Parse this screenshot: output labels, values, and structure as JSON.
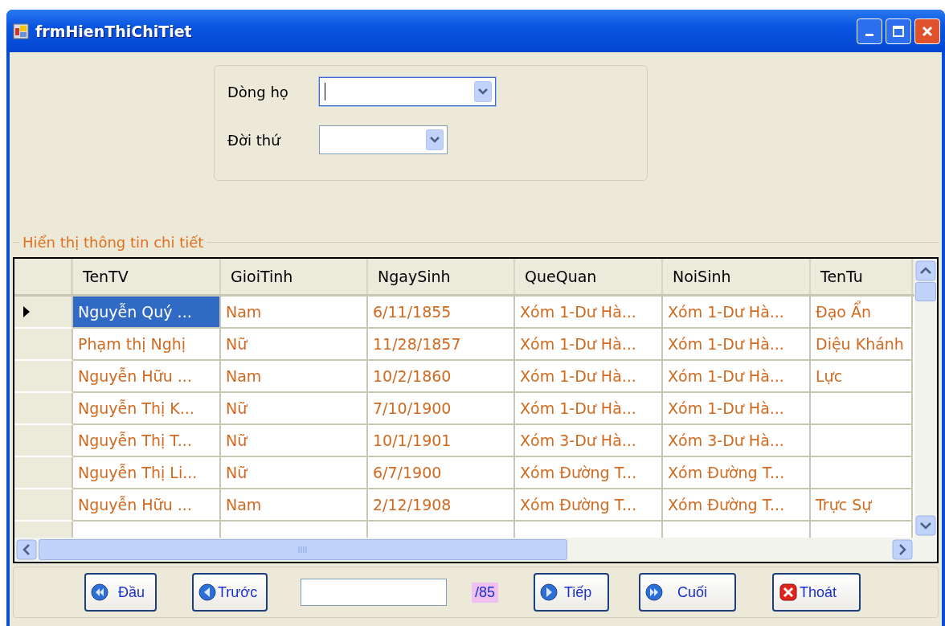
{
  "window": {
    "title": "frmHienThiChiTiet"
  },
  "filters": [
    {
      "label": "Dòng họ",
      "focused": true,
      "wide": true
    },
    {
      "label": "Đời thứ",
      "focused": false,
      "wide": false
    }
  ],
  "details": {
    "title": "Hiển thị thông tin chi tiết",
    "columns": [
      "TenTV",
      "GioiTinh",
      "NgaySinh",
      "QueQuan",
      "NoiSinh",
      "TenTu"
    ],
    "rows": [
      {
        "selected": true,
        "cells": [
          "Nguyễn Quý ...",
          "Nam",
          "6/11/1855",
          "Xóm 1-Dư Hà...",
          "Xóm 1-Dư Hà...",
          "Đạo Ẩn"
        ]
      },
      {
        "selected": false,
        "cells": [
          "Phạm thị Nghị",
          "Nữ",
          "11/28/1857",
          "Xóm 1-Dư Hà...",
          "Xóm 1-Dư Hà...",
          "Diệu Khánh"
        ]
      },
      {
        "selected": false,
        "cells": [
          "Nguyễn Hữu ...",
          "Nam",
          "10/2/1860",
          "Xóm 1-Dư Hà...",
          "Xóm 1-Dư Hà...",
          "Lực"
        ]
      },
      {
        "selected": false,
        "cells": [
          "Nguyễn Thị K...",
          "Nữ",
          "7/10/1900",
          "Xóm 1-Dư Hà...",
          "Xóm 1-Dư Hà...",
          ""
        ]
      },
      {
        "selected": false,
        "cells": [
          "Nguyễn Thị T...",
          "Nữ",
          "10/1/1901",
          "Xóm 3-Dư Hà...",
          "Xóm 3-Dư Hà...",
          ""
        ]
      },
      {
        "selected": false,
        "cells": [
          "Nguyễn Thị Li...",
          "Nữ",
          "6/7/1900",
          "Xóm Đường T...",
          "Xóm Đường T...",
          ""
        ]
      },
      {
        "selected": false,
        "cells": [
          "Nguyễn Hữu ...",
          "Nam",
          "2/12/1908",
          "Xóm Đường T...",
          "Xóm Đường T...",
          "Trực Sự"
        ]
      }
    ]
  },
  "navigation": {
    "buttons": [
      {
        "kind": "first",
        "label": "Đầu"
      },
      {
        "kind": "prev",
        "label": "Trước"
      },
      {
        "kind": "next",
        "label": "Tiếp"
      },
      {
        "kind": "last",
        "label": "Cuối"
      },
      {
        "kind": "exit",
        "label": "Thoát"
      }
    ],
    "count": "/85"
  }
}
